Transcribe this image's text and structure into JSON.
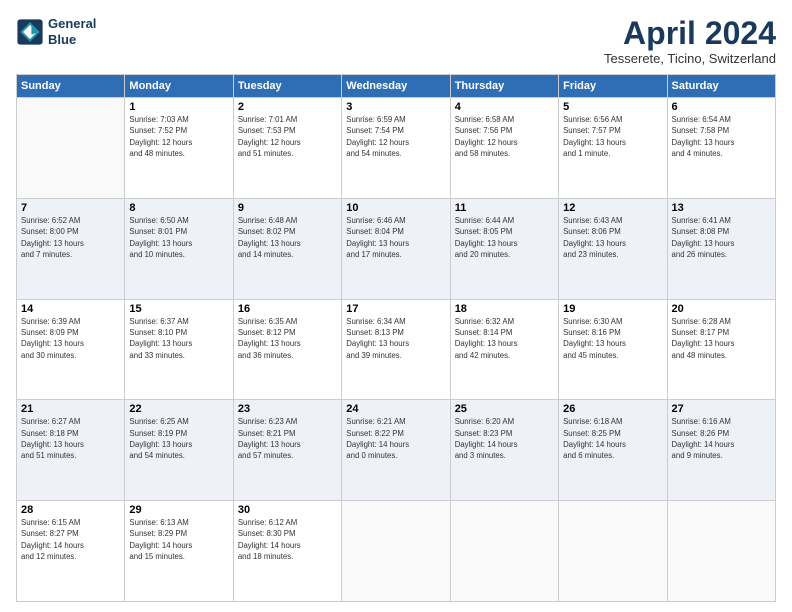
{
  "logo": {
    "line1": "General",
    "line2": "Blue"
  },
  "title": "April 2024",
  "subtitle": "Tesserete, Ticino, Switzerland",
  "columns": [
    "Sunday",
    "Monday",
    "Tuesday",
    "Wednesday",
    "Thursday",
    "Friday",
    "Saturday"
  ],
  "weeks": [
    [
      {
        "day": "",
        "info": ""
      },
      {
        "day": "1",
        "info": "Sunrise: 7:03 AM\nSunset: 7:52 PM\nDaylight: 12 hours\nand 48 minutes."
      },
      {
        "day": "2",
        "info": "Sunrise: 7:01 AM\nSunset: 7:53 PM\nDaylight: 12 hours\nand 51 minutes."
      },
      {
        "day": "3",
        "info": "Sunrise: 6:59 AM\nSunset: 7:54 PM\nDaylight: 12 hours\nand 54 minutes."
      },
      {
        "day": "4",
        "info": "Sunrise: 6:58 AM\nSunset: 7:56 PM\nDaylight: 12 hours\nand 58 minutes."
      },
      {
        "day": "5",
        "info": "Sunrise: 6:56 AM\nSunset: 7:57 PM\nDaylight: 13 hours\nand 1 minute."
      },
      {
        "day": "6",
        "info": "Sunrise: 6:54 AM\nSunset: 7:58 PM\nDaylight: 13 hours\nand 4 minutes."
      }
    ],
    [
      {
        "day": "7",
        "info": "Sunrise: 6:52 AM\nSunset: 8:00 PM\nDaylight: 13 hours\nand 7 minutes."
      },
      {
        "day": "8",
        "info": "Sunrise: 6:50 AM\nSunset: 8:01 PM\nDaylight: 13 hours\nand 10 minutes."
      },
      {
        "day": "9",
        "info": "Sunrise: 6:48 AM\nSunset: 8:02 PM\nDaylight: 13 hours\nand 14 minutes."
      },
      {
        "day": "10",
        "info": "Sunrise: 6:46 AM\nSunset: 8:04 PM\nDaylight: 13 hours\nand 17 minutes."
      },
      {
        "day": "11",
        "info": "Sunrise: 6:44 AM\nSunset: 8:05 PM\nDaylight: 13 hours\nand 20 minutes."
      },
      {
        "day": "12",
        "info": "Sunrise: 6:43 AM\nSunset: 8:06 PM\nDaylight: 13 hours\nand 23 minutes."
      },
      {
        "day": "13",
        "info": "Sunrise: 6:41 AM\nSunset: 8:08 PM\nDaylight: 13 hours\nand 26 minutes."
      }
    ],
    [
      {
        "day": "14",
        "info": "Sunrise: 6:39 AM\nSunset: 8:09 PM\nDaylight: 13 hours\nand 30 minutes."
      },
      {
        "day": "15",
        "info": "Sunrise: 6:37 AM\nSunset: 8:10 PM\nDaylight: 13 hours\nand 33 minutes."
      },
      {
        "day": "16",
        "info": "Sunrise: 6:35 AM\nSunset: 8:12 PM\nDaylight: 13 hours\nand 36 minutes."
      },
      {
        "day": "17",
        "info": "Sunrise: 6:34 AM\nSunset: 8:13 PM\nDaylight: 13 hours\nand 39 minutes."
      },
      {
        "day": "18",
        "info": "Sunrise: 6:32 AM\nSunset: 8:14 PM\nDaylight: 13 hours\nand 42 minutes."
      },
      {
        "day": "19",
        "info": "Sunrise: 6:30 AM\nSunset: 8:16 PM\nDaylight: 13 hours\nand 45 minutes."
      },
      {
        "day": "20",
        "info": "Sunrise: 6:28 AM\nSunset: 8:17 PM\nDaylight: 13 hours\nand 48 minutes."
      }
    ],
    [
      {
        "day": "21",
        "info": "Sunrise: 6:27 AM\nSunset: 8:18 PM\nDaylight: 13 hours\nand 51 minutes."
      },
      {
        "day": "22",
        "info": "Sunrise: 6:25 AM\nSunset: 8:19 PM\nDaylight: 13 hours\nand 54 minutes."
      },
      {
        "day": "23",
        "info": "Sunrise: 6:23 AM\nSunset: 8:21 PM\nDaylight: 13 hours\nand 57 minutes."
      },
      {
        "day": "24",
        "info": "Sunrise: 6:21 AM\nSunset: 8:22 PM\nDaylight: 14 hours\nand 0 minutes."
      },
      {
        "day": "25",
        "info": "Sunrise: 6:20 AM\nSunset: 8:23 PM\nDaylight: 14 hours\nand 3 minutes."
      },
      {
        "day": "26",
        "info": "Sunrise: 6:18 AM\nSunset: 8:25 PM\nDaylight: 14 hours\nand 6 minutes."
      },
      {
        "day": "27",
        "info": "Sunrise: 6:16 AM\nSunset: 8:26 PM\nDaylight: 14 hours\nand 9 minutes."
      }
    ],
    [
      {
        "day": "28",
        "info": "Sunrise: 6:15 AM\nSunset: 8:27 PM\nDaylight: 14 hours\nand 12 minutes."
      },
      {
        "day": "29",
        "info": "Sunrise: 6:13 AM\nSunset: 8:29 PM\nDaylight: 14 hours\nand 15 minutes."
      },
      {
        "day": "30",
        "info": "Sunrise: 6:12 AM\nSunset: 8:30 PM\nDaylight: 14 hours\nand 18 minutes."
      },
      {
        "day": "",
        "info": ""
      },
      {
        "day": "",
        "info": ""
      },
      {
        "day": "",
        "info": ""
      },
      {
        "day": "",
        "info": ""
      }
    ]
  ]
}
